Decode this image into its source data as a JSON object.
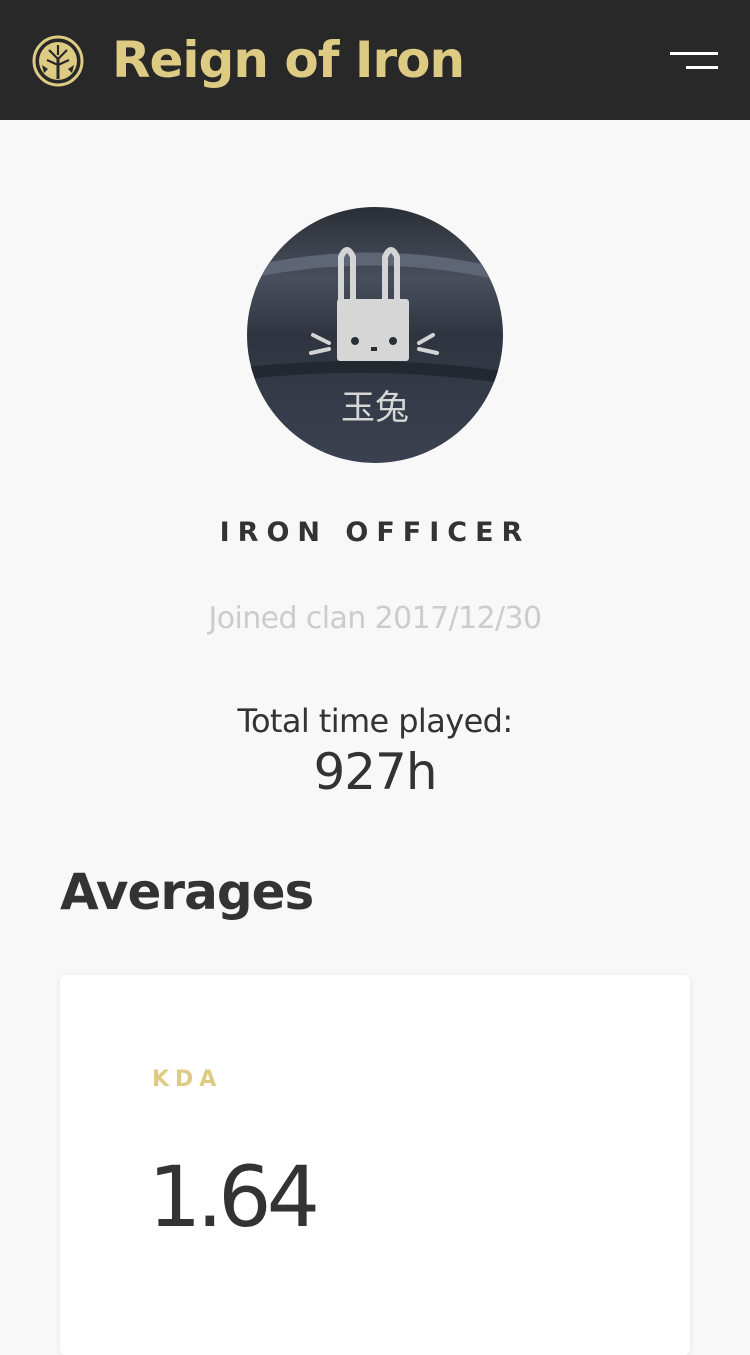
{
  "colors": {
    "header_bg": "#282828",
    "accent_gold": "#decb83",
    "page_bg": "#f8f8f8",
    "text_dark": "#333333",
    "text_muted": "#cccccc"
  },
  "header": {
    "logo_icon": "tree-of-iron-emblem-icon",
    "title": "Reign of Iron",
    "menu_icon": "hamburger-menu-icon"
  },
  "profile": {
    "avatar_icon": "rabbit-emblem-avatar",
    "avatar_text": "玉兔",
    "rank": "IRON OFFICER",
    "joined": "Joined clan 2017/12/30",
    "time_label": "Total time played:",
    "time_value": "927h"
  },
  "averages": {
    "title": "Averages",
    "cards": [
      {
        "label": "KDA",
        "value": "1.64"
      }
    ]
  }
}
